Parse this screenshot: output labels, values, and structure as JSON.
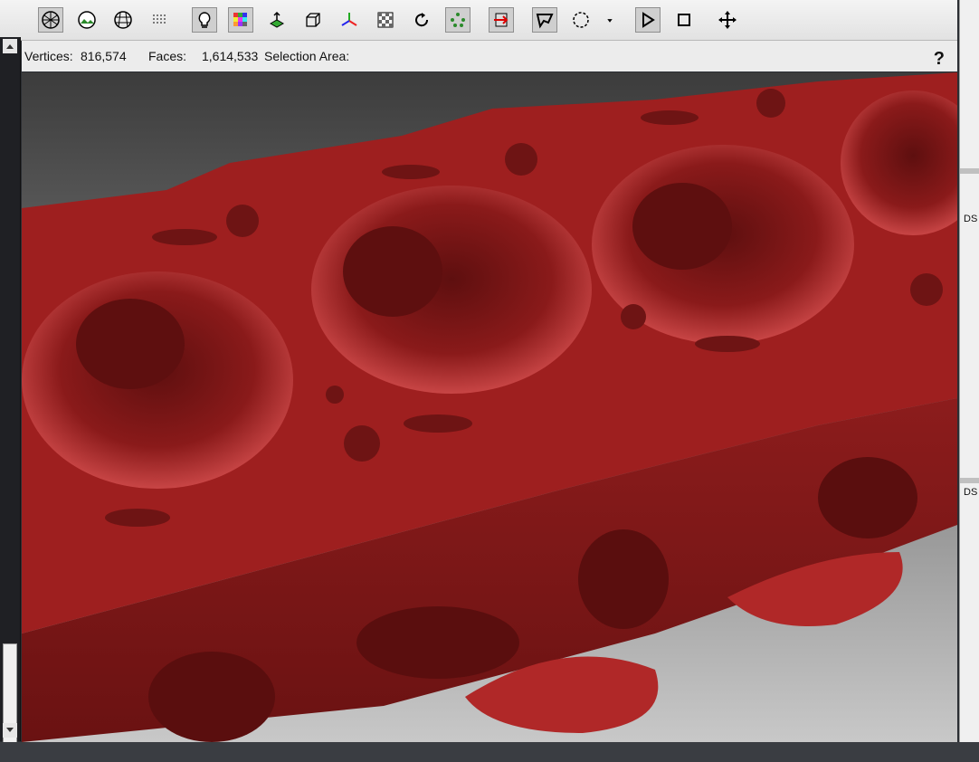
{
  "toolbar": {
    "buttons": [
      {
        "name": "wireframe-sphere-icon",
        "active": true
      },
      {
        "name": "textured-view-icon",
        "active": false
      },
      {
        "name": "shaded-mesh-icon",
        "active": false
      },
      {
        "name": "point-cloud-icon",
        "active": false
      },
      {
        "name": "light-bulb-icon",
        "active": true
      },
      {
        "name": "color-grid-icon",
        "active": true
      },
      {
        "name": "normals-icon",
        "active": false
      },
      {
        "name": "bounding-box-icon",
        "active": false
      },
      {
        "name": "axes-icon",
        "active": false
      },
      {
        "name": "checker-texture-icon",
        "active": false
      },
      {
        "name": "rotate-icon",
        "active": false
      },
      {
        "name": "vertex-points-icon",
        "active": true
      },
      {
        "name": "flip-faces-icon",
        "active": true
      },
      {
        "name": "lasso-select-icon",
        "active": true
      },
      {
        "name": "circle-select-icon",
        "active": false
      },
      {
        "name": "dropdown-arrow-icon",
        "active": false
      },
      {
        "name": "play-icon",
        "active": true
      },
      {
        "name": "stop-icon",
        "active": false
      },
      {
        "name": "move-icon",
        "active": false
      }
    ]
  },
  "info": {
    "vertices_label": "Vertices:",
    "vertices_value": "816,574",
    "faces_label": "Faces:",
    "faces_value": "1,614,533",
    "selection_label": "Selection Area:",
    "help_label": "?"
  },
  "right_panel": {
    "label1": "DS",
    "label2": "DS"
  },
  "colors": {
    "model": "#9e1f1f",
    "model_highlight": "#c84545",
    "model_shadow": "#5e0f0f"
  }
}
